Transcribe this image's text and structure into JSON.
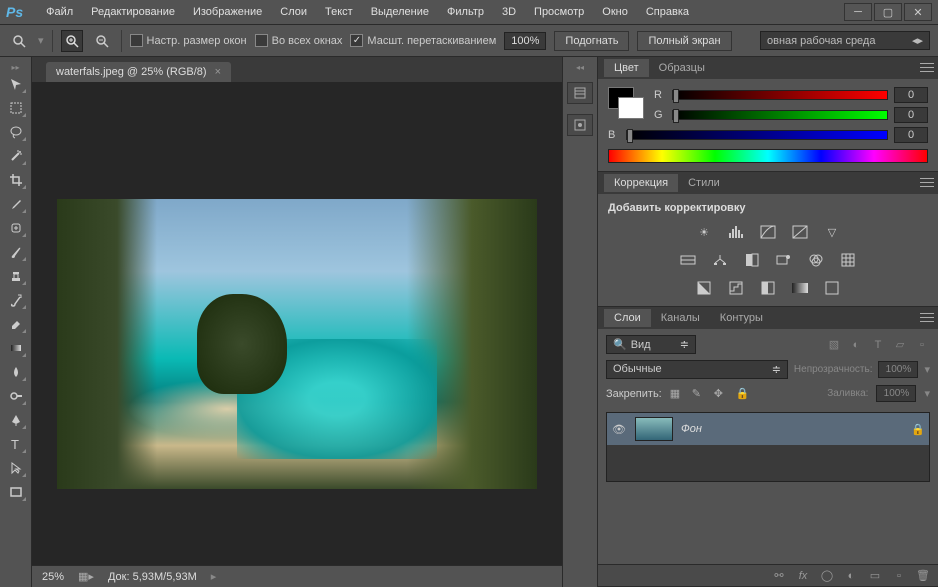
{
  "app": {
    "logo": "Ps"
  },
  "menu": {
    "items": [
      "Файл",
      "Редактирование",
      "Изображение",
      "Слои",
      "Текст",
      "Выделение",
      "Фильтр",
      "3D",
      "Просмотр",
      "Окно",
      "Справка"
    ]
  },
  "options": {
    "resize_windows": "Настр. размер окон",
    "all_windows": "Во всех окнах",
    "scrubby_zoom": "Масшт. перетаскиванием",
    "zoom_value": "100%",
    "fit": "Подогнать",
    "fullscreen": "Полный экран",
    "workspace": "овная рабочая среда"
  },
  "document": {
    "tab_title": "waterfals.jpeg @ 25% (RGB/8)",
    "status_zoom": "25%",
    "status_doc_label": "Док:",
    "status_doc_value": "5,93M/5,93M"
  },
  "color_panel": {
    "tab_color": "Цвет",
    "tab_swatches": "Образцы",
    "r_label": "R",
    "r_value": "0",
    "g_label": "G",
    "g_value": "0",
    "b_label": "B",
    "b_value": "0"
  },
  "adjustments_panel": {
    "tab_adjust": "Коррекция",
    "tab_styles": "Стили",
    "title": "Добавить корректировку"
  },
  "layers_panel": {
    "tab_layers": "Слои",
    "tab_channels": "Каналы",
    "tab_paths": "Контуры",
    "search_placeholder": "Вид",
    "blend_mode": "Обычные",
    "opacity_label": "Непрозрачность:",
    "opacity_value": "100%",
    "lock_label": "Закрепить:",
    "fill_label": "Заливка:",
    "fill_value": "100%",
    "layer_name": "Фон"
  }
}
